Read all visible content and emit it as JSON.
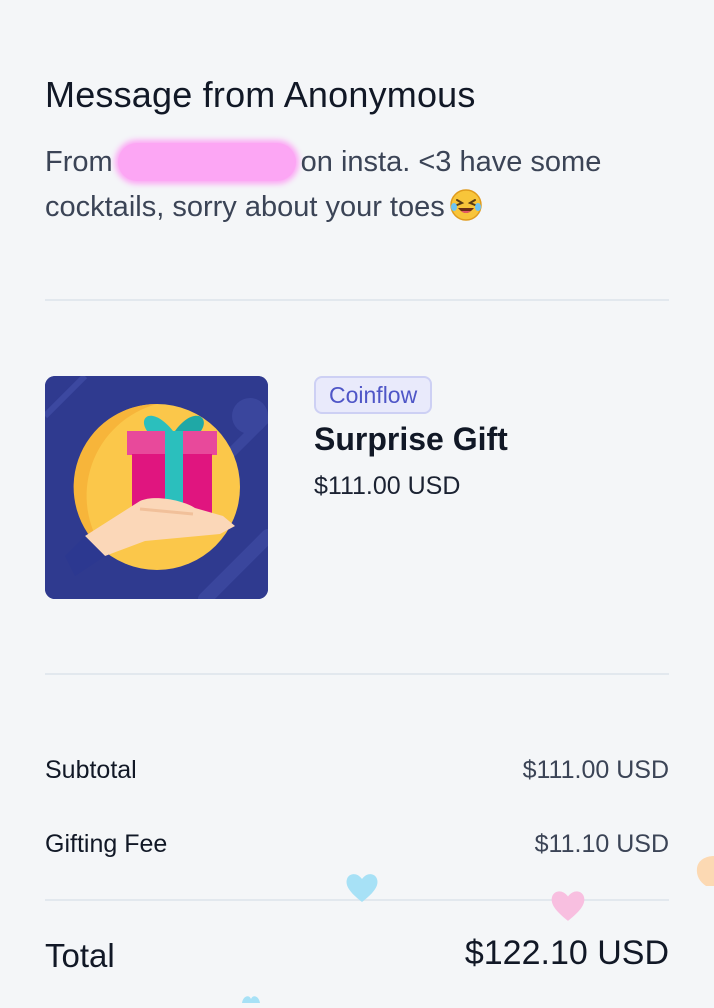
{
  "message": {
    "title": "Message from Anonymous",
    "text_before": "From",
    "text_after": "on insta. <3 have some cocktails, sorry about your toes",
    "emoji_icon": "rolling-on-floor-laughing-emoji"
  },
  "product": {
    "badge": "Coinflow",
    "name": "Surprise Gift",
    "price": "$111.00 USD",
    "image_icon": "gift-in-hand-icon"
  },
  "summary": {
    "subtotal_label": "Subtotal",
    "subtotal_value": "$111.00 USD",
    "fee_label": "Gifting Fee",
    "fee_value": "$11.10 USD",
    "total_label": "Total",
    "total_value": "$122.10 USD"
  },
  "colors": {
    "background": "#f4f6f8",
    "badge_bg": "#e9eafb",
    "badge_text": "#4f56c7",
    "redaction": "#fca6f4",
    "gift_tile_bg": "#2f3a8f"
  },
  "decorations": [
    "blue-heart-icon",
    "pink-heart-icon",
    "peach-heart-icon"
  ]
}
